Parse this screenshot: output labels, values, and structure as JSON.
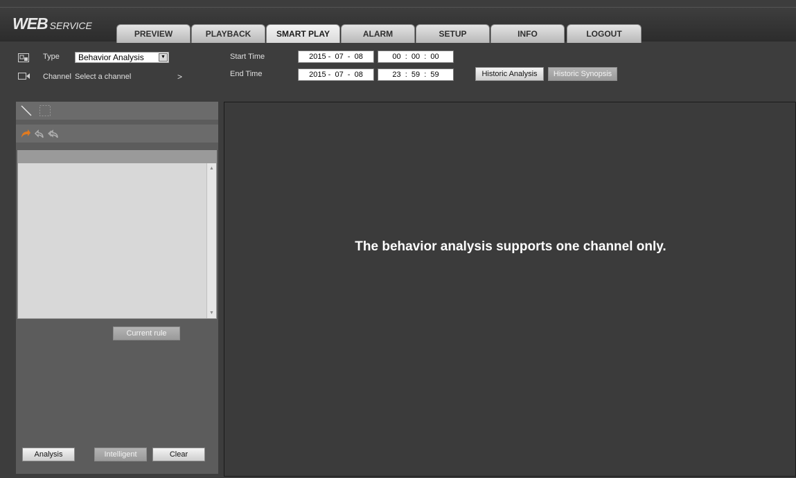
{
  "logo": {
    "primary": "WEB",
    "secondary": "SERVICE"
  },
  "tabs": [
    "PREVIEW",
    "PLAYBACK",
    "SMART PLAY",
    "ALARM",
    "SETUP",
    "INFO",
    "LOGOUT"
  ],
  "active_tab": "SMART PLAY",
  "filter": {
    "type_label": "Type",
    "type_value": "Behavior Analysis",
    "channel_label": "Channel",
    "channel_value": "Select a channel",
    "channel_arrow": ">"
  },
  "time": {
    "start_label": "Start Time",
    "start_date": "2015 -  07  -  08",
    "start_time": "00  :  00  :  00",
    "end_label": "End Time",
    "end_date": "2015 -  07  -  08",
    "end_time": "23  :  59  :  59"
  },
  "buttons": {
    "historic_analysis": "Historic Analysis",
    "historic_synopsis": "Historic Synopsis",
    "current_rule": "Current rule",
    "analysis": "Analysis",
    "intelligent": "Intelligent",
    "clear": "Clear"
  },
  "video": {
    "message": "The behavior analysis supports one channel only."
  },
  "icons": {
    "type": "image-type-icon",
    "channel": "camera-icon",
    "draw_line": "line-tool-icon",
    "draw_rect": "rectangle-tool-icon",
    "redo": "redo-icon",
    "undo": "undo-icon",
    "undo_all": "undo-all-icon"
  },
  "colors": {
    "background": "#3d3d3d",
    "accent_orange": "#e07a1f",
    "tab_active": "#dadada"
  }
}
